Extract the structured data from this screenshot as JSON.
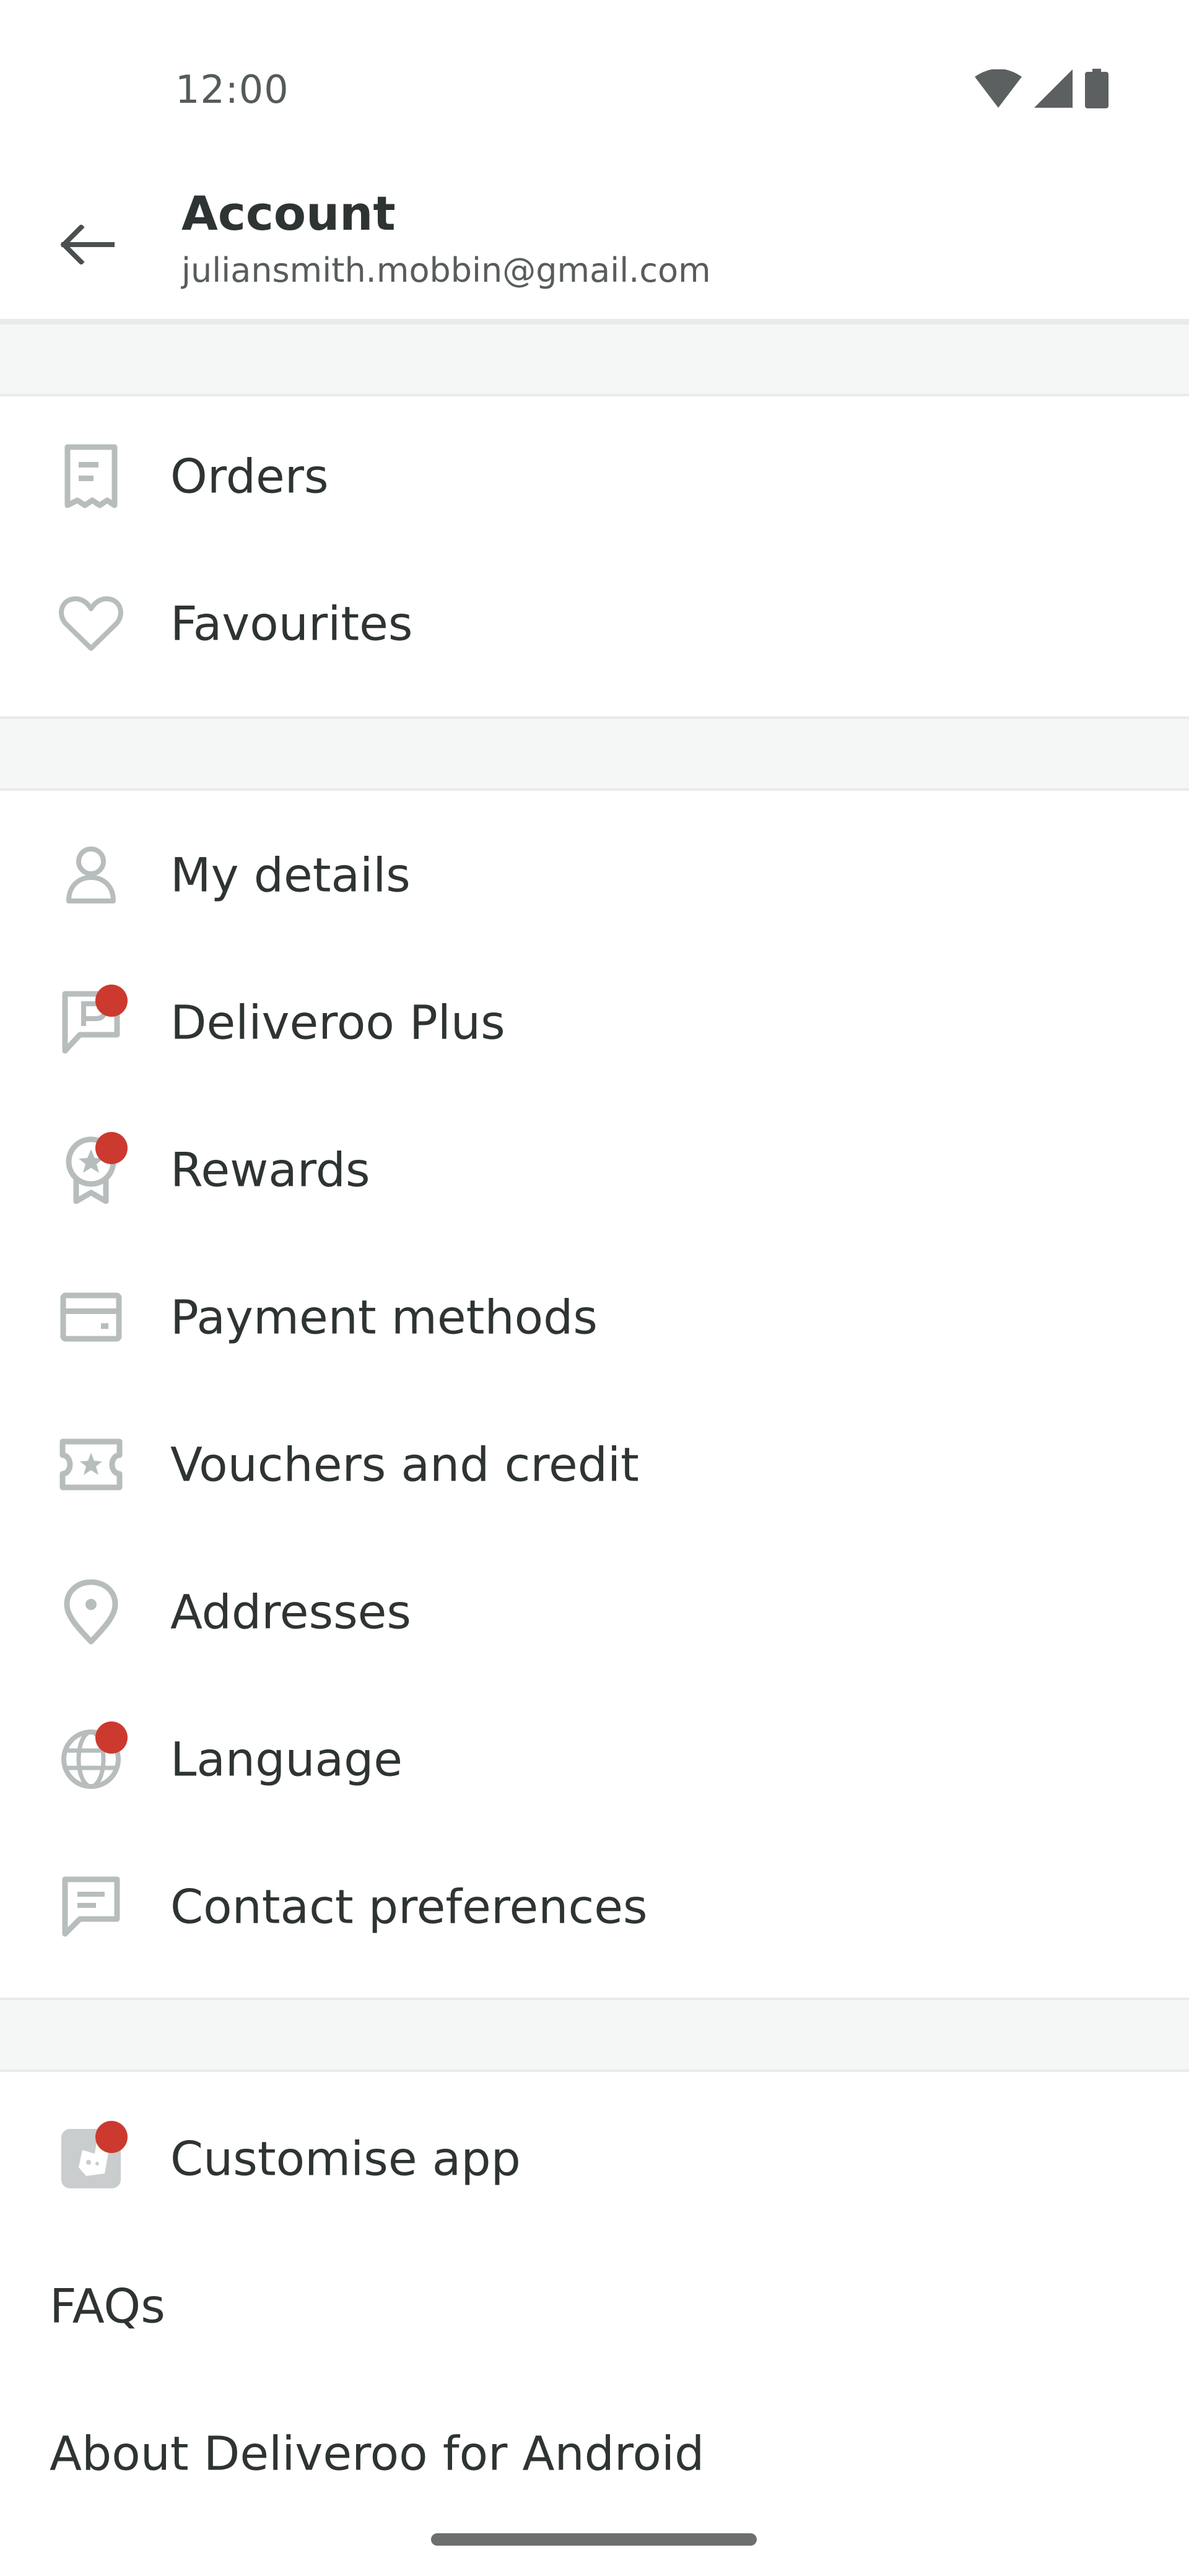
{
  "status_bar": {
    "time": "12:00"
  },
  "header": {
    "title": "Account",
    "email": "juliansmith.mobbin@gmail.com"
  },
  "sections": [
    {
      "items": [
        {
          "label": "Orders",
          "icon": "receipt-icon",
          "notification": false
        },
        {
          "label": "Favourites",
          "icon": "heart-icon",
          "notification": false
        }
      ]
    },
    {
      "items": [
        {
          "label": "My details",
          "icon": "person-icon",
          "notification": false
        },
        {
          "label": "Deliveroo Plus",
          "icon": "plus-badge-icon",
          "notification": true
        },
        {
          "label": "Rewards",
          "icon": "rewards-badge-icon",
          "notification": true
        },
        {
          "label": "Payment methods",
          "icon": "credit-card-icon",
          "notification": false
        },
        {
          "label": "Vouchers and credit",
          "icon": "voucher-ticket-icon",
          "notification": false
        },
        {
          "label": "Addresses",
          "icon": "location-pin-icon",
          "notification": false
        },
        {
          "label": "Language",
          "icon": "globe-icon",
          "notification": true
        },
        {
          "label": "Contact preferences",
          "icon": "chat-bubble-icon",
          "notification": false
        }
      ]
    },
    {
      "items": [
        {
          "label": "Customise app",
          "icon": "deliveroo-logo-icon",
          "notification": true
        },
        {
          "label": "FAQs",
          "icon": "",
          "notification": false
        },
        {
          "label": "About Deliveroo for Android",
          "icon": "",
          "notification": false
        }
      ]
    }
  ],
  "colors": {
    "notification_dot": "#cc3a2f",
    "icon_gray": "#b7bdbd",
    "text": "#2e3333",
    "divider_band": "#f5f6f6"
  }
}
